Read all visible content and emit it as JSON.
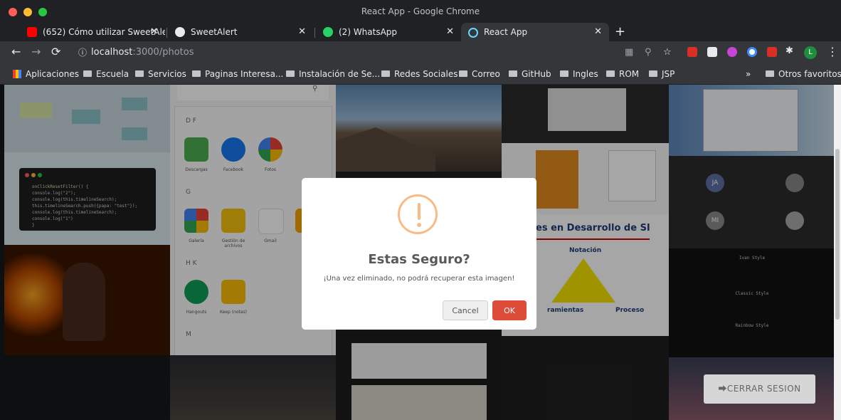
{
  "window": {
    "title": "React App - Google Chrome"
  },
  "tabs": [
    {
      "label": "(652) Cómo utilizar SweetAler",
      "color": "#ff0000",
      "active": false
    },
    {
      "label": "SweetAlert",
      "color": "#e8eaed",
      "active": false
    },
    {
      "label": "(2) WhatsApp",
      "color": "#25d366",
      "active": false
    },
    {
      "label": "React App",
      "color": "#61dafb",
      "active": true
    }
  ],
  "omnibox": {
    "host": "localhost",
    "path": ":3000/photos"
  },
  "bookmarks": [
    {
      "label": "Aplicaciones",
      "x": 18
    },
    {
      "label": "Escuela"
    },
    {
      "label": "Servicios"
    },
    {
      "label": "Paginas Interesa..."
    },
    {
      "label": "Instalación de Se..."
    },
    {
      "label": "Redes Sociales"
    },
    {
      "label": "Correo"
    },
    {
      "label": "GitHub"
    },
    {
      "label": "Ingles"
    },
    {
      "label": "ROM"
    },
    {
      "label": "JSP"
    }
  ],
  "bookmarks_overflow": "»",
  "bookmarks_other": "Otros favoritos",
  "profile_initial": "L",
  "gallery": {
    "apps": {
      "section_df": "D F",
      "section_g": "G",
      "section_hk": "H K",
      "section_m": "M",
      "items": [
        "Descargas",
        "Facebook",
        "Fotos",
        "Galería",
        "Gestión de archivos",
        "Gmail",
        "Hangouts",
        "Keep (notas)"
      ]
    },
    "slide_title": "es en Desarrollo de SI",
    "slide_labels": [
      "Notación",
      "ramientas",
      "Proceso"
    ],
    "meet_initials": [
      "JA",
      "MI"
    ],
    "terminal_lines": [
      "Ivan Style",
      "Classic Style",
      "Rainbow Style"
    ],
    "code": [
      "onClickResetFilter() {",
      "  console.log(\"2\");",
      "  console.log(this.timelineSearch);",
      "  this.timelineSearch.push({papa: \"test\"});",
      "  console.log(this.timelineSearch);",
      "  console.log(\"1\")",
      "}"
    ]
  },
  "modal": {
    "title": "Estas Seguro?",
    "text": "¡Una vez eliminado, no podrá recuperar esta imagen!",
    "cancel_label": "Cancel",
    "ok_label": "OK"
  },
  "logout_label": "⮕CERRAR SESION"
}
